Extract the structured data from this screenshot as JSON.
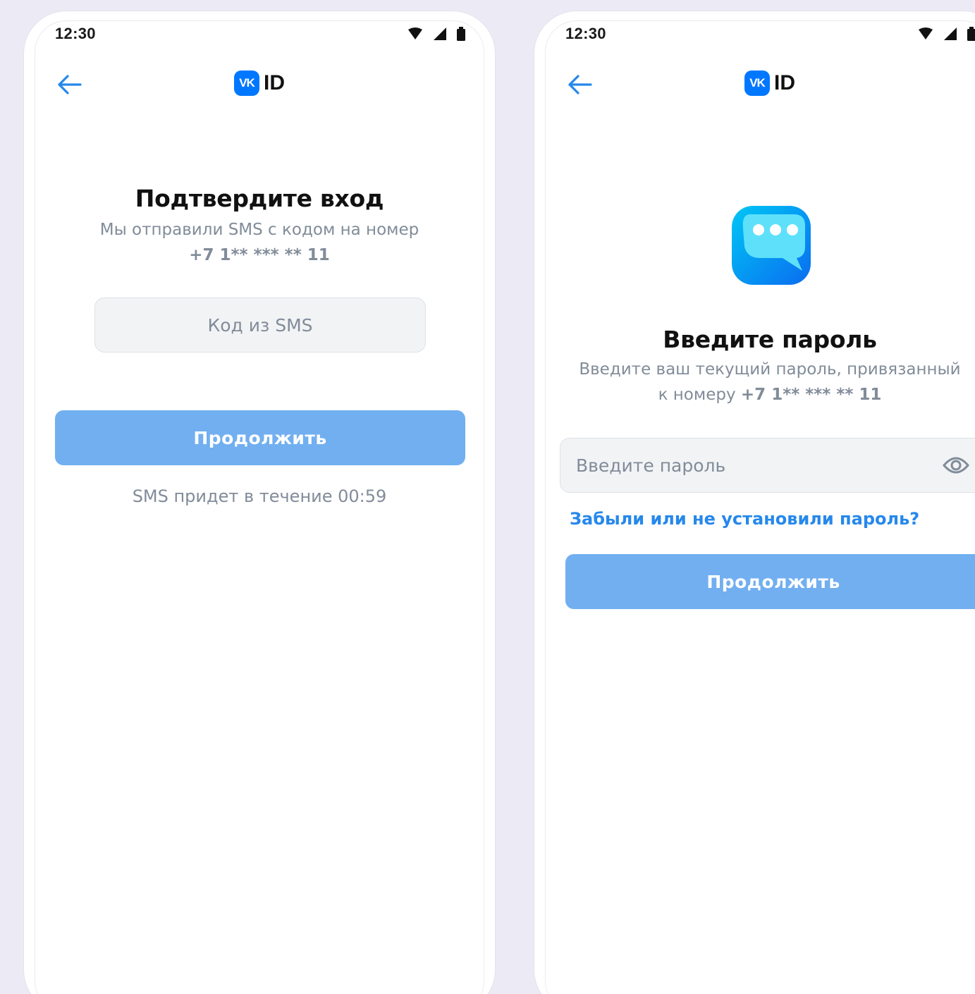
{
  "colors": {
    "accent": "#0077ff",
    "button_disabled": "#71aff0",
    "link": "#2688eb",
    "secondary_text": "#818c99",
    "input_bg": "#f2f3f5"
  },
  "screens": [
    {
      "status_time": "12:30",
      "status_icons": [
        "wifi-icon",
        "signal-icon",
        "battery-icon"
      ],
      "back_icon": "arrow-left-icon",
      "logo_badge": "VK",
      "logo_text": "ID",
      "title": "Подтвердите вход",
      "subtitle": "Мы отправили SMS с кодом на номер",
      "phone": "+7 1** *** ** 11",
      "input_placeholder": "Код из SMS",
      "button_label": "Продолжить",
      "timer_text": "SMS придет в течение 00:59"
    },
    {
      "status_time": "12:30",
      "status_icons": [
        "wifi-icon",
        "signal-icon",
        "battery-icon"
      ],
      "back_icon": "arrow-left-icon",
      "logo_badge": "VK",
      "logo_text": "ID",
      "illustration_icon": "chat-bubble-icon",
      "title": "Введите пароль",
      "subtitle_line1": "Введите ваш текущий пароль, привязанный",
      "subtitle_prefix": "к номеру",
      "phone": "+7 1** *** ** 11",
      "input_placeholder": "Введите пароль",
      "visibility_icon": "eye-icon",
      "forgot_link": "Забыли или не установили пароль?",
      "button_label": "Продолжить"
    }
  ]
}
